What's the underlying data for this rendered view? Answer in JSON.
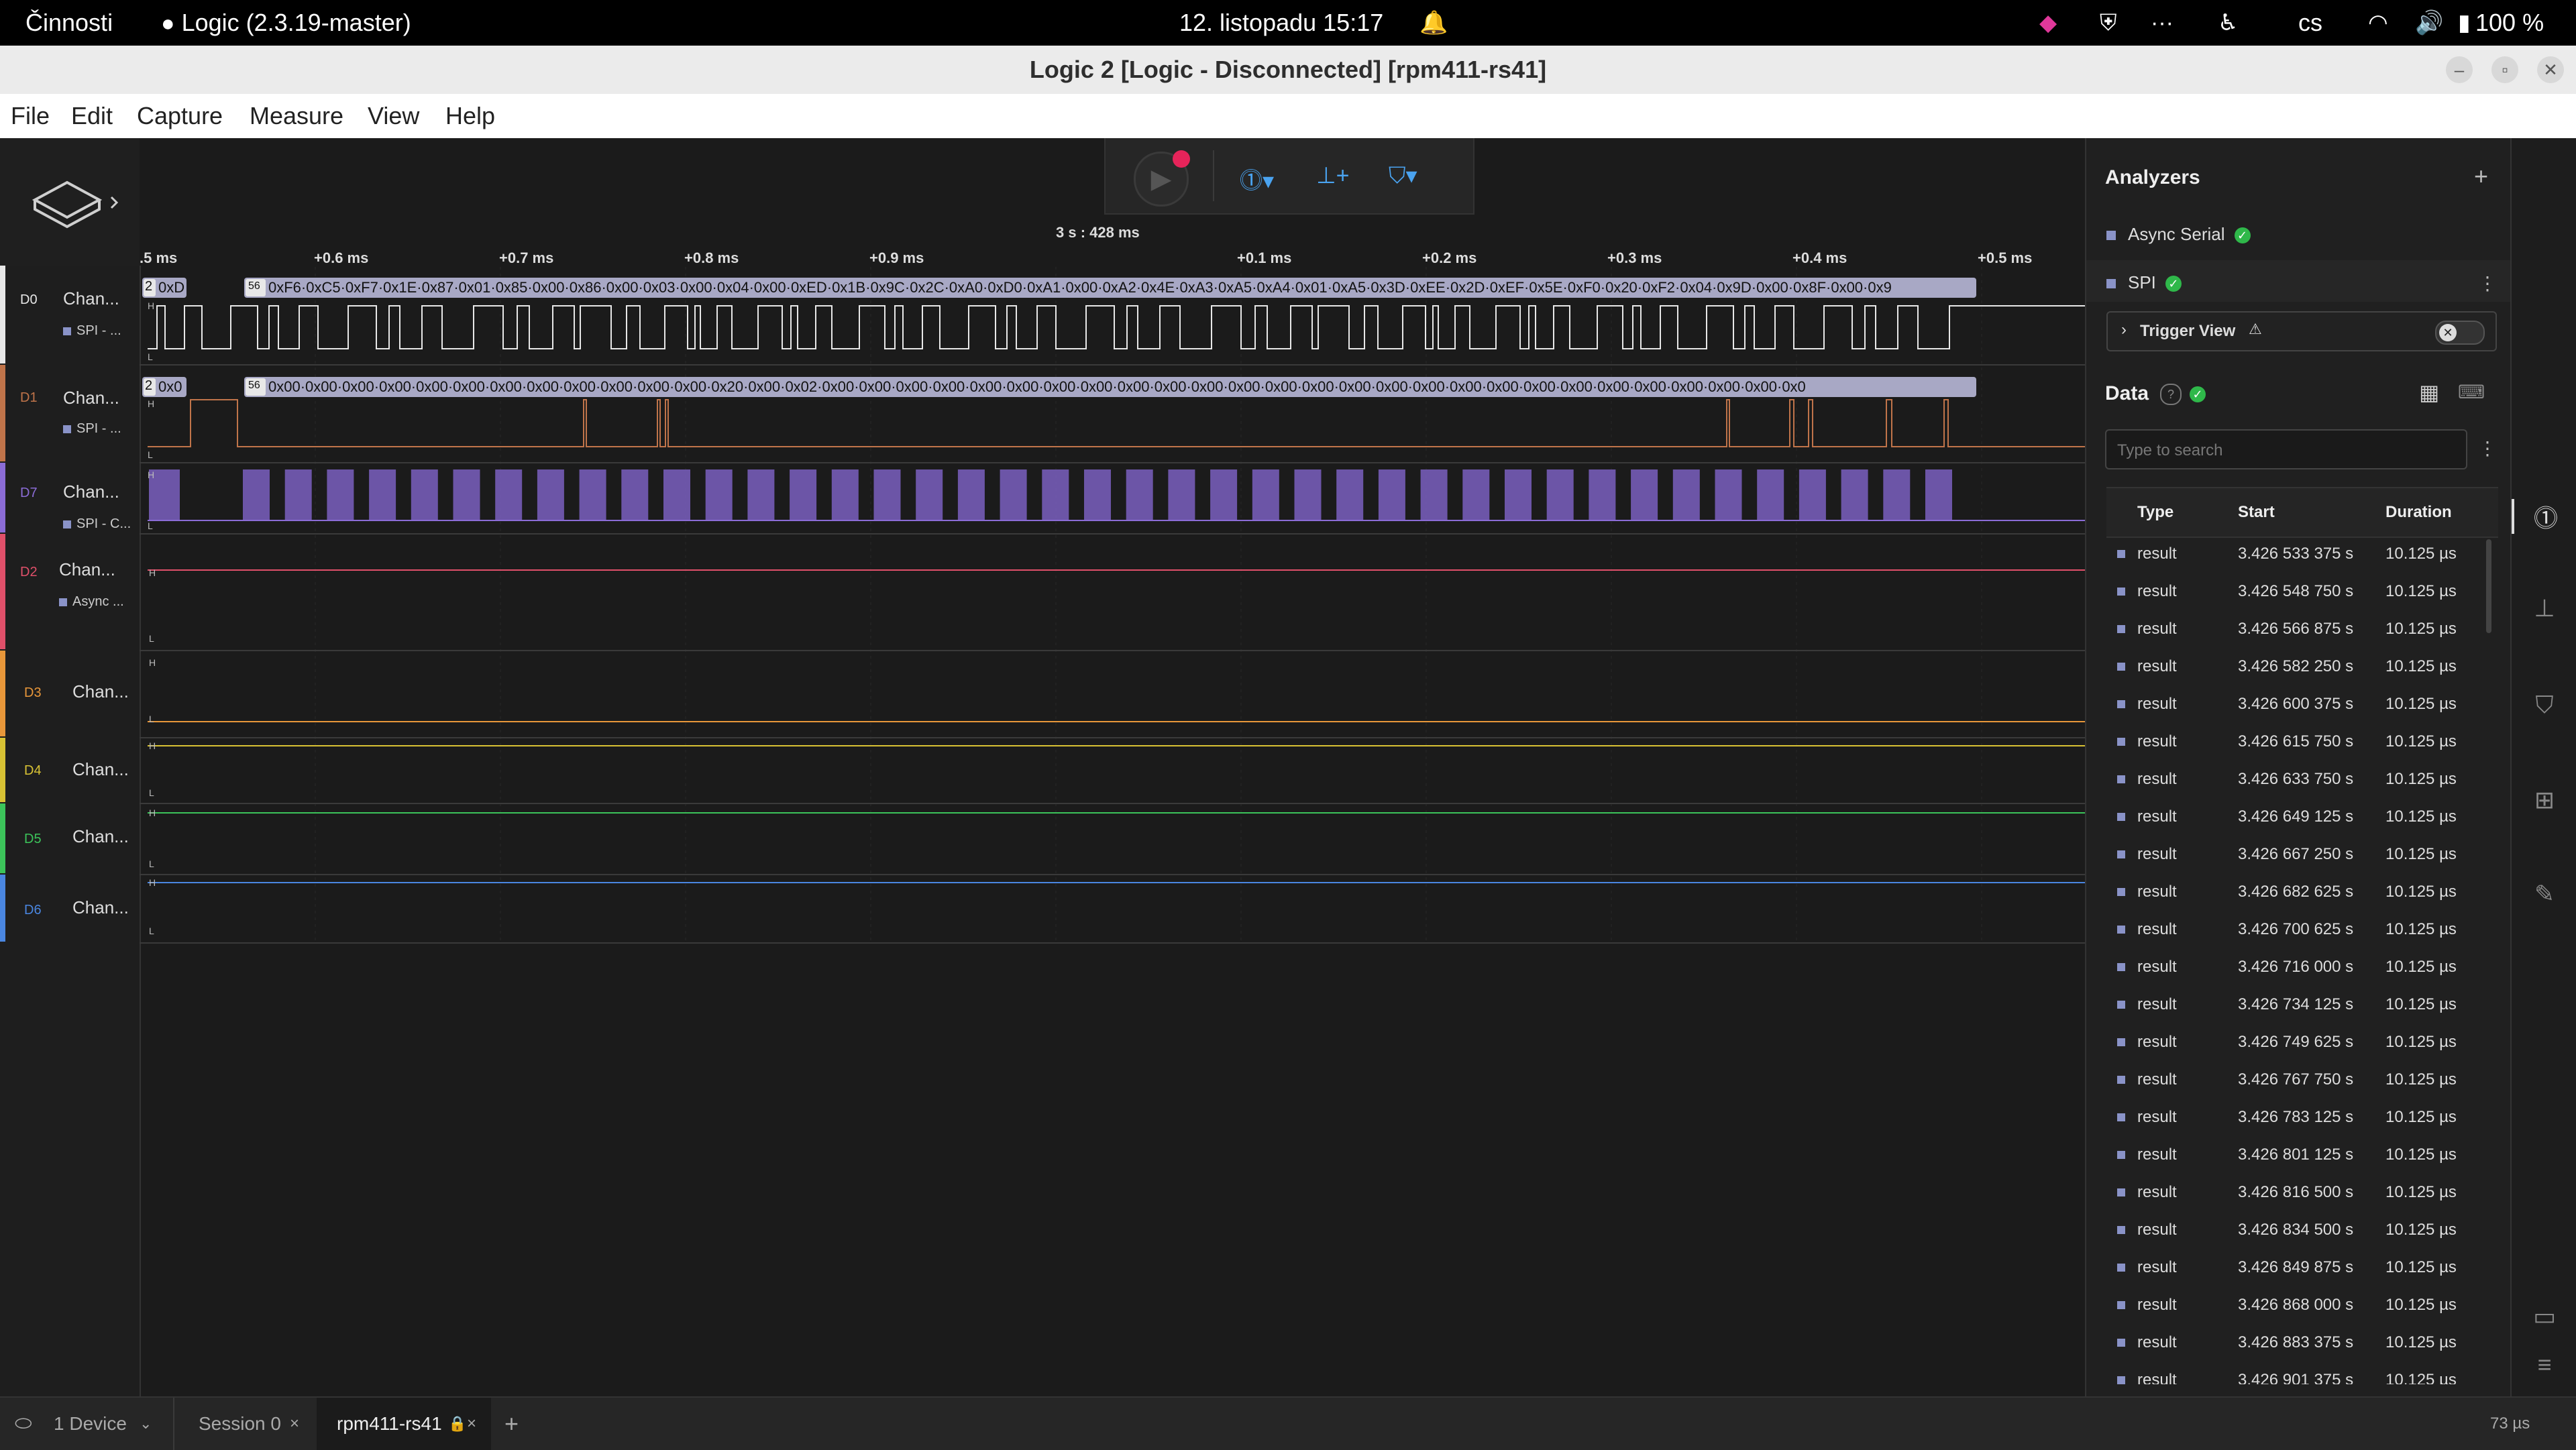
{
  "system": {
    "activities": "Činnosti",
    "app_name": "Logic (2.3.19-master)",
    "clock": "12. listopadu  15:17",
    "language": "cs",
    "battery": "100 %"
  },
  "window": {
    "title": "Logic 2 [Logic - Disconnected] [rpm411-rs41]"
  },
  "menu": [
    "File",
    "Edit",
    "Capture",
    "Measure",
    "View",
    "Help"
  ],
  "ruler": {
    "center": "3 s : 428 ms",
    "ticks": [
      ".5 ms",
      "+0.6 ms",
      "+0.7 ms",
      "+0.8 ms",
      "+0.9 ms",
      "+0.1 ms",
      "+0.2 ms",
      "+0.3 ms",
      "+0.4 ms",
      "+0.5 ms"
    ]
  },
  "channels": [
    {
      "id": "D0",
      "name": "Chan...",
      "analyzer": "SPI - ...",
      "color": "#e8e8e8"
    },
    {
      "id": "D1",
      "name": "Chan...",
      "analyzer": "SPI - ...",
      "color": "#c0744a"
    },
    {
      "id": "D7",
      "name": "Chan...",
      "analyzer": "SPI - C...",
      "color": "#8b6cd6"
    },
    {
      "id": "D2",
      "name": "Chan...",
      "analyzer": "Async ...",
      "color": "#e0506a"
    },
    {
      "id": "D3",
      "name": "Chan...",
      "analyzer": "",
      "color": "#e8973a"
    },
    {
      "id": "D4",
      "name": "Chan...",
      "analyzer": "",
      "color": "#d8c234"
    },
    {
      "id": "D5",
      "name": "Chan...",
      "analyzer": "",
      "color": "#3cc45a"
    },
    {
      "id": "D6",
      "name": "Chan...",
      "analyzer": "",
      "color": "#4a86e0"
    }
  ],
  "decode": {
    "d0_count": "2",
    "d0_first": "0xD",
    "d0_count2": "56",
    "d0_bytes": "0xF6·0xC5·0xF7·0x1E·0x87·0x01·0x85·0x00·0x86·0x00·0x03·0x00·0x04·0x00·0xED·0x1B·0x9C·0x2C·0xA0·0xD0·0xA1·0x00·0xA2·0x4E·0xA3·0xA5·0xA4·0x01·0xA5·0x3D·0xEE·0x2D·0xEF·0x5E·0xF0·0x20·0xF2·0x04·0x9D·0x00·0x8F·0x00·0x9",
    "d1_count": "2",
    "d1_first": "0x0",
    "d1_count2": "56",
    "d1_bytes": "0x00·0x00·0x00·0x00·0x00·0x00·0x00·0x00·0x00·0x00·0x00·0x00·0x20·0x00·0x02·0x00·0x00·0x00·0x00·0x00·0x00·0x00·0x00·0x00·0x00·0x00·0x00·0x00·0x00·0x00·0x00·0x00·0x00·0x00·0x00·0x00·0x00·0x00·0x00·0x00·0x00·0x0",
    "h": "H",
    "l": "L"
  },
  "analyzers": {
    "title": "Analyzers",
    "add": "+",
    "items": [
      {
        "name": "Async Serial"
      },
      {
        "name": "SPI"
      }
    ],
    "trigger_label": "Trigger View"
  },
  "data_panel": {
    "title": "Data",
    "search_placeholder": "Type to search",
    "columns": [
      "Type",
      "Start",
      "Duration"
    ],
    "rows": [
      {
        "type": "result",
        "start": "3.426 533 375 s",
        "duration": "10.125 µs"
      },
      {
        "type": "result",
        "start": "3.426 548 750 s",
        "duration": "10.125 µs"
      },
      {
        "type": "result",
        "start": "3.426 566 875 s",
        "duration": "10.125 µs"
      },
      {
        "type": "result",
        "start": "3.426 582 250 s",
        "duration": "10.125 µs"
      },
      {
        "type": "result",
        "start": "3.426 600 375 s",
        "duration": "10.125 µs"
      },
      {
        "type": "result",
        "start": "3.426 615 750 s",
        "duration": "10.125 µs"
      },
      {
        "type": "result",
        "start": "3.426 633 750 s",
        "duration": "10.125 µs"
      },
      {
        "type": "result",
        "start": "3.426 649 125 s",
        "duration": "10.125 µs"
      },
      {
        "type": "result",
        "start": "3.426 667 250 s",
        "duration": "10.125 µs"
      },
      {
        "type": "result",
        "start": "3.426 682 625 s",
        "duration": "10.125 µs"
      },
      {
        "type": "result",
        "start": "3.426 700 625 s",
        "duration": "10.125 µs"
      },
      {
        "type": "result",
        "start": "3.426 716 000 s",
        "duration": "10.125 µs"
      },
      {
        "type": "result",
        "start": "3.426 734 125 s",
        "duration": "10.125 µs"
      },
      {
        "type": "result",
        "start": "3.426 749 625 s",
        "duration": "10.125 µs"
      },
      {
        "type": "result",
        "start": "3.426 767 750 s",
        "duration": "10.125 µs"
      },
      {
        "type": "result",
        "start": "3.426 783 125 s",
        "duration": "10.125 µs"
      },
      {
        "type": "result",
        "start": "3.426 801 125 s",
        "duration": "10.125 µs"
      },
      {
        "type": "result",
        "start": "3.426 816 500 s",
        "duration": "10.125 µs"
      },
      {
        "type": "result",
        "start": "3.426 834 500 s",
        "duration": "10.125 µs"
      },
      {
        "type": "result",
        "start": "3.426 849 875 s",
        "duration": "10.125 µs"
      },
      {
        "type": "result",
        "start": "3.426 868 000 s",
        "duration": "10.125 µs"
      },
      {
        "type": "result",
        "start": "3.426 883 375 s",
        "duration": "10.125 µs"
      },
      {
        "type": "result",
        "start": "3.426 901 375 s",
        "duration": "10.125 µs"
      }
    ]
  },
  "bottom": {
    "device": "1 Device",
    "tabs": [
      {
        "label": "Session 0"
      },
      {
        "label": "rpm411-rs41"
      }
    ],
    "add_tab": "+",
    "timing": "73 µs"
  },
  "icons": {
    "record_color": "#e6245a",
    "ok_color": "#2fb84a",
    "accent": "#4aa3f0"
  }
}
